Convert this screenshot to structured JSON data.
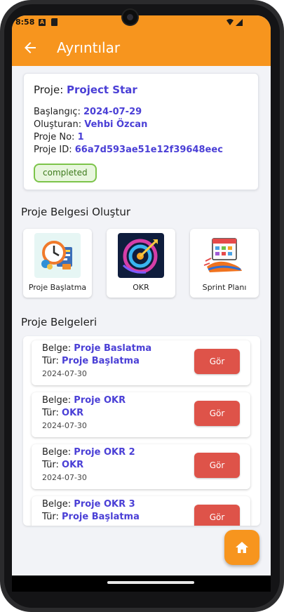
{
  "status_bar": {
    "time": "8:58",
    "a_icon_letter": "A"
  },
  "app_bar": {
    "title": "Ayrıntılar",
    "back_icon": "arrow-left-icon"
  },
  "project": {
    "name_label": "Proje: ",
    "name": "Project Star",
    "start_label": "Başlangıç: ",
    "start": "2024-07-29",
    "creator_label": "Oluşturan: ",
    "creator": "Vehbi Özcan",
    "no_label": "Proje No: ",
    "no": "1",
    "id_label": "Proje ID: ",
    "id": "66a7d593ae51e12f39648eec",
    "status": "completed"
  },
  "create_section": {
    "title": "Proje Belgesi Oluştur",
    "tiles": [
      {
        "label": "Proje Başlatma",
        "icon": "project-start-illustration"
      },
      {
        "label": "OKR",
        "icon": "okr-target-illustration"
      },
      {
        "label": "Sprint Planı",
        "icon": "sprint-plan-illustration"
      }
    ]
  },
  "docs_section": {
    "title": "Proje Belgeleri",
    "doc_label": "Belge: ",
    "type_label": "Tür: ",
    "view_label": "Gör",
    "documents": [
      {
        "name": "Proje Baslatma",
        "type": "Proje Başlatma",
        "date": "2024-07-30"
      },
      {
        "name": "Proje OKR",
        "type": "OKR",
        "date": "2024-07-30"
      },
      {
        "name": "Proje OKR 2",
        "type": "OKR",
        "date": "2024-07-30"
      },
      {
        "name": "Proje OKR 3",
        "type": "Proje Başlatma",
        "date": ""
      }
    ]
  },
  "fab": {
    "icon": "home-icon"
  },
  "colors": {
    "accent": "#f7951e",
    "link": "#4a3fd6",
    "button": "#de5349",
    "badge_border": "#7cc44a"
  }
}
